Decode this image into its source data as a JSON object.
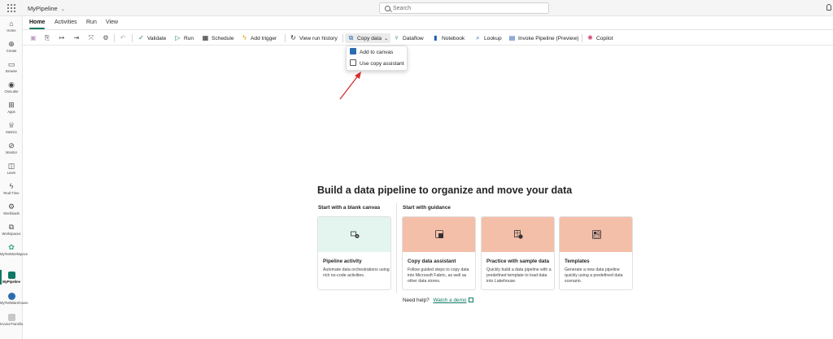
{
  "header": {
    "app_title": "MyPipeline",
    "search_placeholder": "Search"
  },
  "rail": {
    "items": [
      {
        "label": "Home",
        "icon": "home-icon"
      },
      {
        "label": "Create",
        "icon": "plus-circle-icon"
      },
      {
        "label": "Browse",
        "icon": "folder-icon"
      },
      {
        "label": "OneLake",
        "icon": "onelake-icon"
      },
      {
        "label": "Apps",
        "icon": "apps-icon"
      },
      {
        "label": "Metrics",
        "icon": "trophy-icon"
      },
      {
        "label": "Monitor",
        "icon": "monitor-icon"
      },
      {
        "label": "Learn",
        "icon": "book-icon"
      },
      {
        "label": "Real-Time",
        "icon": "lightning-icon"
      },
      {
        "label": "Workloads",
        "icon": "workloads-icon"
      },
      {
        "label": "Workspaces",
        "icon": "workspaces-icon"
      },
      {
        "label": "MyTestWorkspace",
        "icon": "workspace-icon"
      },
      {
        "label": "MyPipeline",
        "icon": "pipeline-icon"
      },
      {
        "label": "MyTestWarehouse",
        "icon": "warehouse-icon"
      },
      {
        "label": "InvoiceTransformOrder(...",
        "icon": "notebook-icon"
      }
    ]
  },
  "tabs": [
    "Home",
    "Activities",
    "Run",
    "View"
  ],
  "toolbar": {
    "validate": "Validate",
    "run": "Run",
    "schedule": "Schedule",
    "add_trigger": "Add trigger",
    "view_run_history": "View run history",
    "copy_data": "Copy data",
    "dataflow": "Dataflow",
    "notebook": "Notebook",
    "lookup": "Lookup",
    "invoke_pipeline": "Invoke Pipeline (Preview)",
    "copilot": "Copilot"
  },
  "copy_menu": {
    "add_to_canvas": "Add to canvas",
    "use_copy_assistant": "Use copy assistant"
  },
  "main": {
    "headline": "Build a data pipeline to organize and move your data",
    "blank_section": "Start with a blank canvas",
    "guidance_section": "Start with guidance",
    "cards": [
      {
        "title": "Pipeline activity",
        "desc": "Automate data orchestrations using rich no-code activities."
      },
      {
        "title": "Copy data assistant",
        "desc": "Follow guided steps to copy data into Microsoft Fabric, as well as other data stores."
      },
      {
        "title": "Practice with sample data",
        "desc": "Quickly build a data pipeline with a predefined template to load data into Lakehouse."
      },
      {
        "title": "Templates",
        "desc": "Generate a new data pipeline quickly using a predefined data scenario."
      }
    ],
    "help_text": "Need help?",
    "help_link": "Watch a demo"
  },
  "colors": {
    "accent": "#117865",
    "blank_banner": "#e3f5ee",
    "guidance_banner": "#f4bfa9"
  }
}
